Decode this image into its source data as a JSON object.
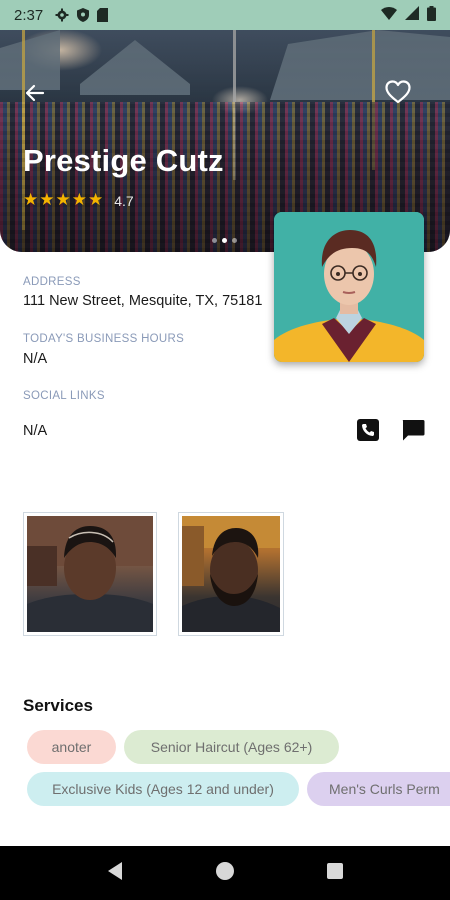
{
  "status_bar": {
    "time": "2:37",
    "icons": [
      "gear-icon",
      "shield-icon",
      "sd-card-icon",
      "wifi-icon",
      "signal-icon",
      "battery-icon"
    ]
  },
  "shop": {
    "name": "Prestige Cutz",
    "rating": "4.7",
    "stars": 5,
    "carousel_pages": 3,
    "carousel_active": 1
  },
  "icons": {
    "back": "arrow-back-icon",
    "favorite": "heart-outline-icon",
    "phone": "phone-icon",
    "chat": "chat-icon"
  },
  "info": {
    "address_label": "ADDRESS",
    "address_value": "111 New Street, Mesquite, TX, 75181",
    "hours_label": "TODAY'S BUSINESS HOURS",
    "hours_value": "N/A",
    "social_label": "SOCIAL LINKS",
    "social_value": "N/A"
  },
  "gallery": {
    "count": 2
  },
  "services": {
    "title": "Services",
    "chips": [
      {
        "label": "anoter",
        "color": "#fbd9d3"
      },
      {
        "label": "Senior Haircut (Ages 62+)",
        "color": "#dcebd2"
      },
      {
        "label": "Exclusive Kids (Ages 12 and under)",
        "color": "#cdeef0"
      },
      {
        "label": "Men's Curls Perm",
        "color": "#dcd0ef"
      }
    ]
  },
  "colors": {
    "status_bar": "#9fcdb8",
    "star": "#f5b400",
    "label": "#8a9ab8",
    "nav_bar": "#000000"
  }
}
